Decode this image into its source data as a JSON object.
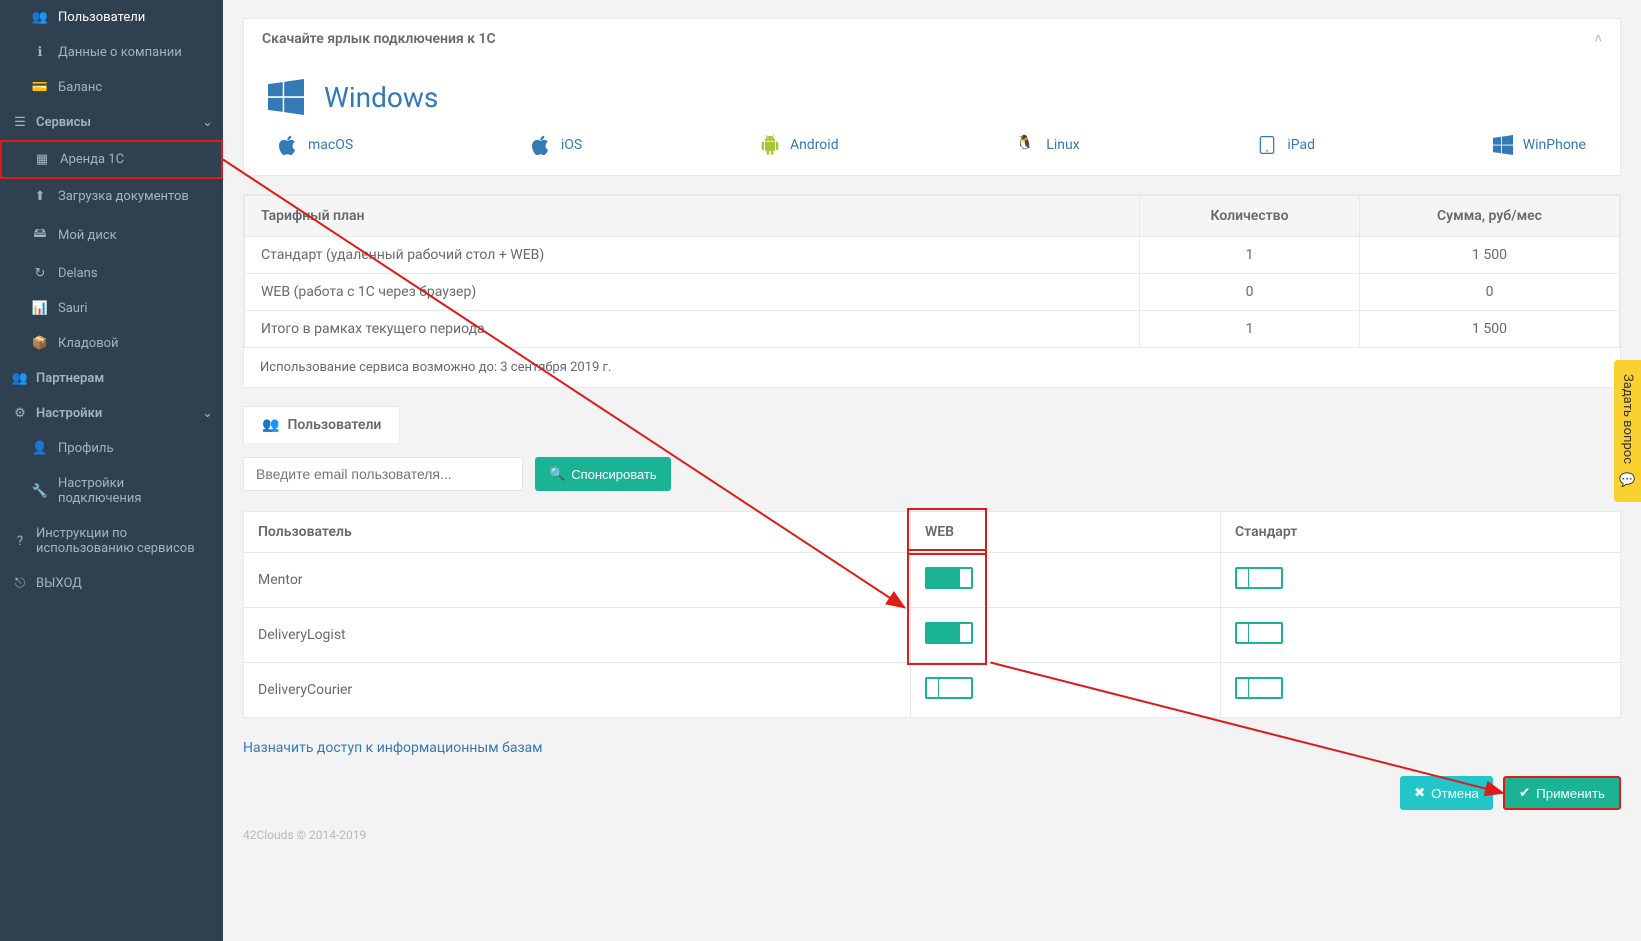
{
  "sidebar": {
    "items_top": [
      {
        "label": "Пользователи"
      },
      {
        "label": "Данные о компании"
      },
      {
        "label": "Баланс"
      }
    ],
    "section_services": "Сервисы",
    "services": [
      {
        "label": "Аренда 1С"
      },
      {
        "label": "Загрузка документов"
      },
      {
        "label": "Мой диск"
      },
      {
        "label": "Delans"
      },
      {
        "label": "Sauri"
      },
      {
        "label": "Кладовой"
      }
    ],
    "partners": "Партнерам",
    "section_settings": "Настройки",
    "settings": [
      {
        "label": "Профиль"
      },
      {
        "label": "Настройки подключения"
      }
    ],
    "instructions": "Инструкции по использованию сервисов",
    "exit": "ВЫХОД"
  },
  "download_panel": {
    "title": "Скачайте ярлык подключения к 1С",
    "primary": "Windows",
    "others": [
      "macOS",
      "iOS",
      "Android",
      "Linux",
      "iPad",
      "WinPhone"
    ]
  },
  "tariff": {
    "headers": [
      "Тарифный план",
      "Количество",
      "Сумма, руб/мес"
    ],
    "rows": [
      {
        "name": "Стандарт (удаленный рабочий стол + WEB)",
        "qty": "1",
        "sum": "1 500"
      },
      {
        "name": "WEB (работа с 1С через браузер)",
        "qty": "0",
        "sum": "0"
      },
      {
        "name": "Итого в рамках текущего периода",
        "qty": "1",
        "sum": "1 500"
      }
    ],
    "note": "Использование сервиса возможно до: 3 сентября 2019 г."
  },
  "tabs": {
    "users": "Пользователи"
  },
  "search": {
    "placeholder": "Введите email пользователя...",
    "sponsor": "Спонсировать"
  },
  "users_table": {
    "headers": {
      "user": "Пользователь",
      "web": "WEB",
      "standard": "Стандарт"
    },
    "rows": [
      {
        "name": "Mentor",
        "web": true,
        "standard": false
      },
      {
        "name": "DeliveryLogist",
        "web": true,
        "standard": false
      },
      {
        "name": "DeliveryCourier",
        "web": false,
        "standard": false
      }
    ]
  },
  "link_access": "Назначить доступ к информационным базам",
  "buttons": {
    "cancel": "Отмена",
    "apply": "Применить"
  },
  "copyright": "42Clouds © 2014-2019",
  "feedback": "Задать вопрос"
}
